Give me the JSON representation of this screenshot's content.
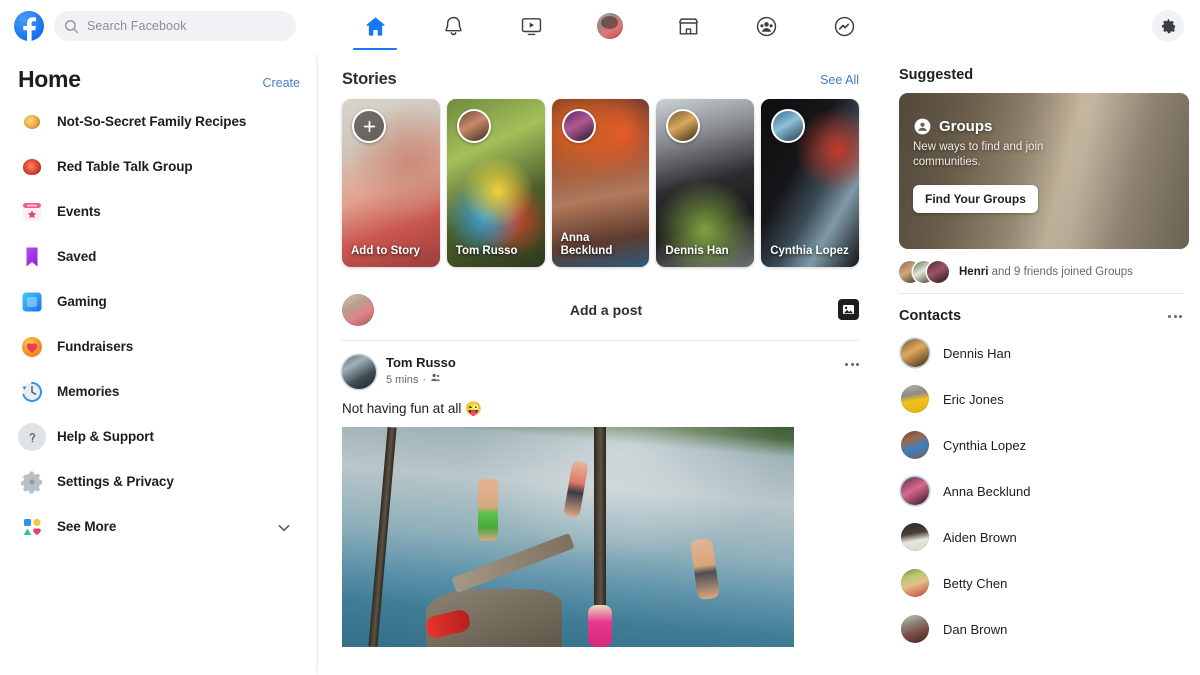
{
  "topbar": {
    "logo_icon": "facebook-logo",
    "logo_color": "#1877F2",
    "search": {
      "placeholder": "Search Facebook",
      "value": "",
      "icon": "search-icon"
    },
    "nav": [
      {
        "icon": "home-icon",
        "label": "Home",
        "active": true
      },
      {
        "icon": "bell-icon",
        "label": "Notifications",
        "active": false
      },
      {
        "icon": "watch-video-icon",
        "label": "Watch",
        "active": false
      },
      {
        "icon": "profile-avatar-icon",
        "label": "Profile",
        "active": false
      },
      {
        "icon": "marketplace-storefront-icon",
        "label": "Marketplace",
        "active": false
      },
      {
        "icon": "groups-icon",
        "label": "Groups",
        "active": false
      },
      {
        "icon": "messenger-icon",
        "label": "Messenger",
        "active": false
      }
    ],
    "settings": {
      "icon": "gear-icon",
      "label": "Settings"
    }
  },
  "sidebar": {
    "title": "Home",
    "create_label": "Create",
    "items": [
      {
        "label": "Not-So-Secret Family Recipes",
        "icon": "group-thumbnail-recipes"
      },
      {
        "label": "Red Table Talk Group",
        "icon": "group-thumbnail-red-table-talk"
      },
      {
        "label": "Events",
        "icon": "events-calendar-icon"
      },
      {
        "label": "Saved",
        "icon": "saved-bookmark-icon"
      },
      {
        "label": "Gaming",
        "icon": "gaming-controller-icon"
      },
      {
        "label": "Fundraisers",
        "icon": "fundraisers-heart-icon"
      },
      {
        "label": "Memories",
        "icon": "memories-clock-icon"
      },
      {
        "label": "Help & Support",
        "icon": "help-question-icon"
      },
      {
        "label": "Settings & Privacy",
        "icon": "settings-gear-icon"
      },
      {
        "label": "See More",
        "icon": "see-more-grid-icon",
        "chevron": "chevron-down-icon"
      }
    ]
  },
  "feed": {
    "stories": {
      "title": "Stories",
      "see_all_label": "See All",
      "items": [
        {
          "name": "Add to Story",
          "is_add": true,
          "avatar_icon": "plus-icon"
        },
        {
          "name": "Tom Russo",
          "is_add": false
        },
        {
          "name": "Anna Becklund",
          "is_add": false
        },
        {
          "name": "Dennis Han",
          "is_add": false
        },
        {
          "name": "Cynthia Lopez",
          "is_add": false
        }
      ]
    },
    "composer": {
      "placeholder": "Add a post",
      "avatar_icon": "user-avatar",
      "photo_icon": "photo-image-icon"
    },
    "post": {
      "author": "Tom Russo",
      "time": "5 mins",
      "audience_icon": "friends-audience-icon",
      "more_icon": "more-options-icon",
      "text": "Not having fun at all 😜",
      "photo_alt": "people jumping off a dock into a lake"
    }
  },
  "rightbar": {
    "suggested_title": "Suggested",
    "groups_card": {
      "icon": "groups-icon",
      "title": "Groups",
      "subtitle": "New ways to find and join communities.",
      "button_label": "Find Your Groups"
    },
    "joined": {
      "highlight": "Henri",
      "text": " and 9 friends joined Groups"
    },
    "contacts": {
      "title": "Contacts",
      "more_icon": "more-options-icon",
      "items": [
        {
          "name": "Dennis Han",
          "active_ring": true
        },
        {
          "name": "Eric Jones",
          "active_ring": false
        },
        {
          "name": "Cynthia Lopez",
          "active_ring": false
        },
        {
          "name": "Anna Becklund",
          "active_ring": true
        },
        {
          "name": "Aiden Brown",
          "active_ring": false
        },
        {
          "name": "Betty Chen",
          "active_ring": false
        },
        {
          "name": "Dan Brown",
          "active_ring": false
        }
      ]
    }
  },
  "colors": {
    "accent": "#1877F2",
    "link": "#3d7cc9",
    "bg": "#ffffff",
    "muted": "#65676b",
    "chip": "#f0f2f5"
  }
}
